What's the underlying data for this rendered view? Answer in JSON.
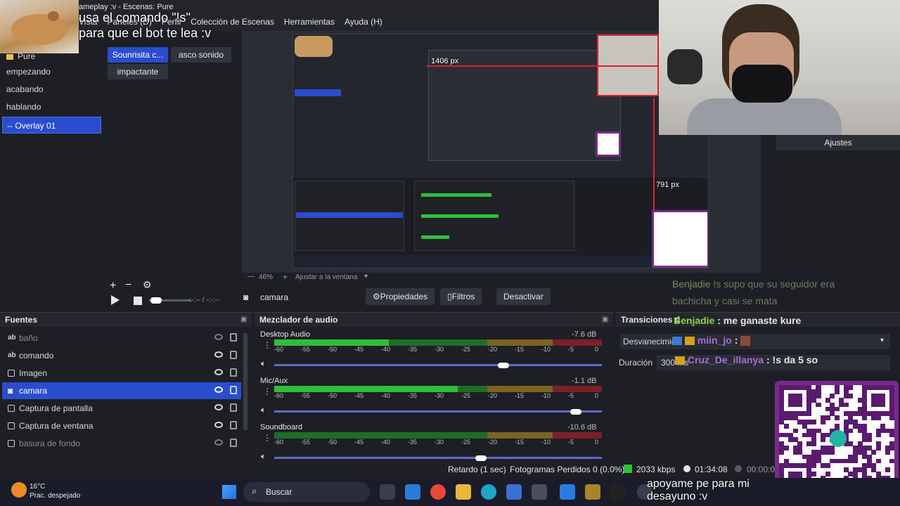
{
  "window": {
    "title": "ameplay :v - Escenas: Pure",
    "overlay_command_line1": "usa el comando \"!s\"",
    "overlay_command_line2": "para que el bot te lea :v"
  },
  "menubar": [
    "Vista",
    "Paneles (D)",
    "Perfil",
    "Colección de Escenas",
    "Herramientas",
    "Ayuda (H)"
  ],
  "scenes": {
    "items": [
      {
        "label": "Pure",
        "folder": true
      },
      {
        "label": "empezando"
      },
      {
        "label": "acabando"
      },
      {
        "label": "hablando"
      },
      {
        "label": "-- Overlay 01",
        "selected": true
      }
    ]
  },
  "soundboard": {
    "buttons": [
      {
        "label": "Sounrisita c...",
        "selected": true
      },
      {
        "label": "asco sonido"
      },
      {
        "label": "impactante"
      }
    ]
  },
  "preview": {
    "px_label_1": "1406 px",
    "px_label_2": "791 px",
    "zoom": "46%",
    "fit_label": "Ajustar a la ventana"
  },
  "webcam": {
    "settings_label": "Ajustes"
  },
  "chat": {
    "faded_user": "Benjadie",
    "faded_msg1": "!s supo que su seguidor era",
    "faded_msg2": "bachicha y casi se mata",
    "line1_user": "Benjadie",
    "line1_msg": ": me ganaste kure",
    "line2_user": "miin_jo",
    "line2_msg": ":",
    "line3_user": "Cruz_De_illanya",
    "line3_msg": ": !s da 5 so",
    "donation_line1": "apoyame pe para mi",
    "donation_line2": "desayuno :v"
  },
  "source_controls": {
    "current_source": "camara",
    "properties": "Propiedades",
    "filters": "Filtros",
    "deactivate": "Desactivar",
    "time": "-:-:-- / -:-:--"
  },
  "sources": {
    "title": "Fuentes",
    "items": [
      {
        "label": "baño",
        "hidden": true
      },
      {
        "label": "comando"
      },
      {
        "label": "Imagen"
      },
      {
        "label": "camara",
        "selected": true
      },
      {
        "label": "Captura de pantalla"
      },
      {
        "label": "Captura de ventana"
      },
      {
        "label": "basura de fondo",
        "hidden": true
      }
    ]
  },
  "mixer": {
    "title": "Mezclador de audio",
    "ticks": [
      "-60",
      "-55",
      "-50",
      "-45",
      "-40",
      "-35",
      "-30",
      "-25",
      "-20",
      "-15",
      "-10",
      "-5",
      "0"
    ],
    "channels": [
      {
        "name": "Desktop Audio",
        "db": "-7.6 dB",
        "level": 0.35,
        "volume": 0.7
      },
      {
        "name": "Mic/Aux",
        "db": "-1.1 dB",
        "level": 0.56,
        "volume": 0.92
      },
      {
        "name": "Soundboard",
        "db": "-10.6 dB",
        "level": 0.0,
        "volume": 0.63
      }
    ]
  },
  "transitions": {
    "title": "Transiciones d",
    "fade_label": "Desvanecimie",
    "duration_label": "Duración",
    "duration_value": "300 ms"
  },
  "status": {
    "delay": "Retardo (1 sec)",
    "dropped": "Fotogramas Perdidos 0 (0.0%)",
    "bitrate": "2033 kbps",
    "live_time": "01:34:08",
    "rec_time": "00:00:0"
  },
  "taskbar": {
    "weather_temp": "16°C",
    "weather_desc": "Prac. despejado",
    "search": "Buscar"
  },
  "colors": {
    "accent": "#2a4dd0",
    "meter_green": "#2fbf3a",
    "meter_yellow": "#c8a228",
    "meter_red": "#c8303a",
    "chat_green": "#8fd147",
    "chat_purple": "#a86bd8"
  }
}
